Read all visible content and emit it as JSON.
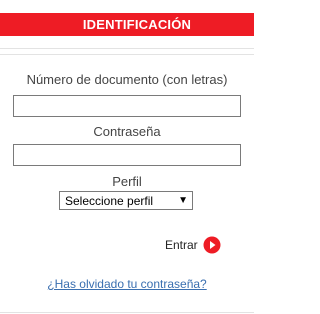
{
  "header": {
    "title": "IDENTIFICACIÓN"
  },
  "form": {
    "document_label": "Número de documento (con letras)",
    "document_value": "",
    "password_label": "Contraseña",
    "password_value": "",
    "profile_label": "Perfil",
    "profile_selected": "Seleccione perfil",
    "profile_arrow": "▼",
    "enter_label": "Entrar",
    "forgot_link": "¿Has olvidado tu contraseña?"
  },
  "icons": {
    "enter": "arrow-right-circle-icon",
    "profile_dropdown": "chevron-down-icon"
  },
  "colors": {
    "brand_red": "#ee1c25",
    "link_blue": "#3a6fb0"
  }
}
